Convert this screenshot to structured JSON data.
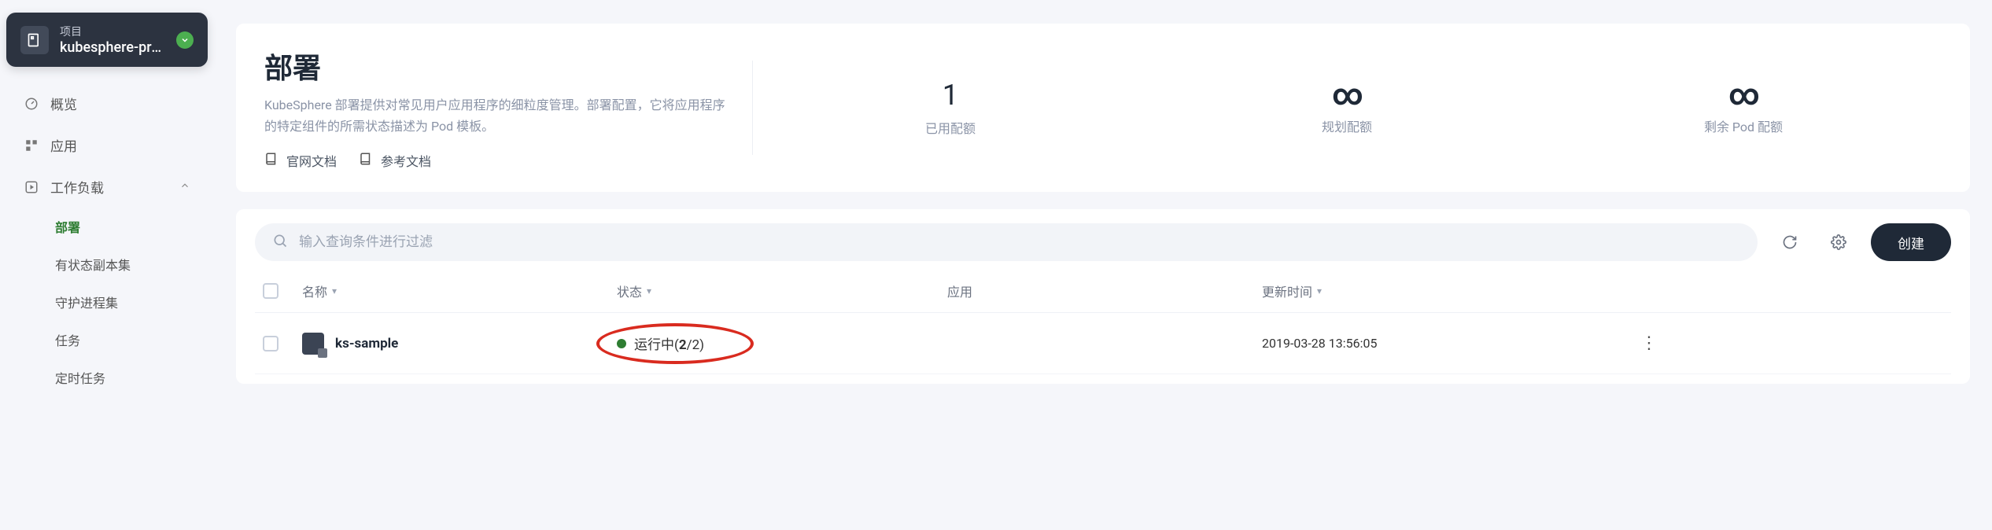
{
  "project": {
    "label": "项目",
    "name": "kubesphere-prod(..."
  },
  "sidebar": {
    "items": [
      {
        "label": "概览",
        "icon": "gauge"
      },
      {
        "label": "应用",
        "icon": "grid"
      },
      {
        "label": "工作负载",
        "icon": "play",
        "expanded": true,
        "children": [
          {
            "label": "部署",
            "active": true
          },
          {
            "label": "有状态副本集"
          },
          {
            "label": "守护进程集"
          },
          {
            "label": "任务"
          },
          {
            "label": "定时任务"
          }
        ]
      }
    ]
  },
  "header": {
    "title": "部署",
    "description": "KubeSphere 部署提供对常见用户应用程序的细粒度管理。部署配置，它将应用程序的特定组件的所需状态描述为 Pod 模板。",
    "docs": [
      {
        "label": "官网文档"
      },
      {
        "label": "参考文档"
      }
    ],
    "stats": [
      {
        "value": "1",
        "label": "已用配额"
      },
      {
        "value": "∞",
        "label": "规划配额",
        "infinity": true
      },
      {
        "value": "∞",
        "label": "剩余 Pod 配额",
        "infinity": true
      }
    ]
  },
  "toolbar": {
    "search_placeholder": "输入查询条件进行过滤",
    "create_label": "创建"
  },
  "table": {
    "columns": {
      "name": "名称",
      "status": "状态",
      "app": "应用",
      "updated": "更新时间"
    },
    "rows": [
      {
        "name": "ks-sample",
        "status_text": "运行中",
        "status_ratio_current": "2",
        "status_ratio_total": "/2",
        "updated": "2019-03-28 13:56:05"
      }
    ]
  }
}
